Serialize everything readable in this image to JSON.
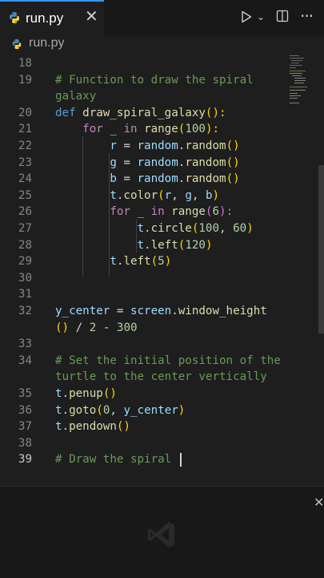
{
  "tab": {
    "filename": "run.py",
    "close": "✕"
  },
  "breadcrumb": {
    "filename": "run.py"
  },
  "toolbar": {
    "run_icon": "play-icon",
    "run_menu_icon": "chevron-down-icon",
    "split_icon": "split-editor-icon",
    "more_icon": "more-actions-icon",
    "chevron": "⌄",
    "more": "···"
  },
  "editor": {
    "line_numbers": [
      "18",
      "19",
      "",
      "20",
      "21",
      "22",
      "23",
      "24",
      "25",
      "26",
      "27",
      "28",
      "29",
      "30",
      "31",
      "32",
      "",
      "33",
      "34",
      "",
      "35",
      "36",
      "37",
      "38",
      "39"
    ],
    "lines": [
      [],
      [
        {
          "t": "# Function to draw the spiral",
          "c": "c-com"
        }
      ],
      [
        {
          "t": "galaxy",
          "c": "c-com"
        }
      ],
      [
        {
          "t": "def ",
          "c": "c-def"
        },
        {
          "t": "draw_spiral_galaxy",
          "c": "c-fn"
        },
        {
          "t": "():",
          "c": "c-p1"
        }
      ],
      [
        {
          "t": "    for ",
          "c": "c-kw"
        },
        {
          "t": "_ ",
          "c": "c-var"
        },
        {
          "t": "in ",
          "c": "c-kw"
        },
        {
          "t": "range",
          "c": "c-fn"
        },
        {
          "t": "(",
          "c": "c-p1"
        },
        {
          "t": "100",
          "c": "c-num"
        },
        {
          "t": "):",
          "c": "c-p1"
        }
      ],
      [
        {
          "t": "        r ",
          "c": "c-var"
        },
        {
          "t": "= ",
          "c": "c-txt"
        },
        {
          "t": "random",
          "c": "c-var"
        },
        {
          "t": ".",
          "c": "c-txt"
        },
        {
          "t": "random",
          "c": "c-fn"
        },
        {
          "t": "()",
          "c": "c-p1"
        }
      ],
      [
        {
          "t": "        g ",
          "c": "c-var"
        },
        {
          "t": "= ",
          "c": "c-txt"
        },
        {
          "t": "random",
          "c": "c-var"
        },
        {
          "t": ".",
          "c": "c-txt"
        },
        {
          "t": "random",
          "c": "c-fn"
        },
        {
          "t": "()",
          "c": "c-p1"
        }
      ],
      [
        {
          "t": "        b ",
          "c": "c-var"
        },
        {
          "t": "= ",
          "c": "c-txt"
        },
        {
          "t": "random",
          "c": "c-var"
        },
        {
          "t": ".",
          "c": "c-txt"
        },
        {
          "t": "random",
          "c": "c-fn"
        },
        {
          "t": "()",
          "c": "c-p1"
        }
      ],
      [
        {
          "t": "        t",
          "c": "c-var"
        },
        {
          "t": ".",
          "c": "c-txt"
        },
        {
          "t": "color",
          "c": "c-fn"
        },
        {
          "t": "(",
          "c": "c-p1"
        },
        {
          "t": "r",
          "c": "c-var"
        },
        {
          "t": ", ",
          "c": "c-txt"
        },
        {
          "t": "g",
          "c": "c-var"
        },
        {
          "t": ", ",
          "c": "c-txt"
        },
        {
          "t": "b",
          "c": "c-var"
        },
        {
          "t": ")",
          "c": "c-p1"
        }
      ],
      [
        {
          "t": "        for ",
          "c": "c-kw"
        },
        {
          "t": "_ ",
          "c": "c-var"
        },
        {
          "t": "in ",
          "c": "c-kw"
        },
        {
          "t": "range",
          "c": "c-fn"
        },
        {
          "t": "(",
          "c": "c-p2"
        },
        {
          "t": "6",
          "c": "c-num"
        },
        {
          "t": "):",
          "c": "c-p2"
        }
      ],
      [
        {
          "t": "            t",
          "c": "c-var"
        },
        {
          "t": ".",
          "c": "c-txt"
        },
        {
          "t": "circle",
          "c": "c-fn"
        },
        {
          "t": "(",
          "c": "c-p1"
        },
        {
          "t": "100",
          "c": "c-num"
        },
        {
          "t": ", ",
          "c": "c-txt"
        },
        {
          "t": "60",
          "c": "c-num"
        },
        {
          "t": ")",
          "c": "c-p1"
        }
      ],
      [
        {
          "t": "            t",
          "c": "c-var"
        },
        {
          "t": ".",
          "c": "c-txt"
        },
        {
          "t": "left",
          "c": "c-fn"
        },
        {
          "t": "(",
          "c": "c-p1"
        },
        {
          "t": "120",
          "c": "c-num"
        },
        {
          "t": ")",
          "c": "c-p1"
        }
      ],
      [
        {
          "t": "        t",
          "c": "c-var"
        },
        {
          "t": ".",
          "c": "c-txt"
        },
        {
          "t": "left",
          "c": "c-fn"
        },
        {
          "t": "(",
          "c": "c-p1"
        },
        {
          "t": "5",
          "c": "c-num"
        },
        {
          "t": ")",
          "c": "c-p1"
        }
      ],
      [],
      [],
      [
        {
          "t": "y_center ",
          "c": "c-var"
        },
        {
          "t": "= ",
          "c": "c-txt"
        },
        {
          "t": "screen",
          "c": "c-var"
        },
        {
          "t": ".",
          "c": "c-txt"
        },
        {
          "t": "window_height",
          "c": "c-fn"
        }
      ],
      [
        {
          "t": "() ",
          "c": "c-p1"
        },
        {
          "t": "/ ",
          "c": "c-txt"
        },
        {
          "t": "2 ",
          "c": "c-num"
        },
        {
          "t": "- ",
          "c": "c-txt"
        },
        {
          "t": "300",
          "c": "c-num"
        }
      ],
      [],
      [
        {
          "t": "# Set the initial position of the",
          "c": "c-com"
        }
      ],
      [
        {
          "t": "turtle to the center vertically",
          "c": "c-com"
        }
      ],
      [
        {
          "t": "t",
          "c": "c-var"
        },
        {
          "t": ".",
          "c": "c-txt"
        },
        {
          "t": "penup",
          "c": "c-fn"
        },
        {
          "t": "()",
          "c": "c-p1"
        }
      ],
      [
        {
          "t": "t",
          "c": "c-var"
        },
        {
          "t": ".",
          "c": "c-txt"
        },
        {
          "t": "goto",
          "c": "c-fn"
        },
        {
          "t": "(",
          "c": "c-p1"
        },
        {
          "t": "0",
          "c": "c-num"
        },
        {
          "t": ", ",
          "c": "c-txt"
        },
        {
          "t": "y_center",
          "c": "c-var"
        },
        {
          "t": ")",
          "c": "c-p1"
        }
      ],
      [
        {
          "t": "t",
          "c": "c-var"
        },
        {
          "t": ".",
          "c": "c-txt"
        },
        {
          "t": "pendown",
          "c": "c-fn"
        },
        {
          "t": "()",
          "c": "c-p1"
        }
      ],
      [],
      [
        {
          "t": "# Draw the spiral ",
          "c": "c-com"
        }
      ]
    ],
    "active_line": "39"
  }
}
